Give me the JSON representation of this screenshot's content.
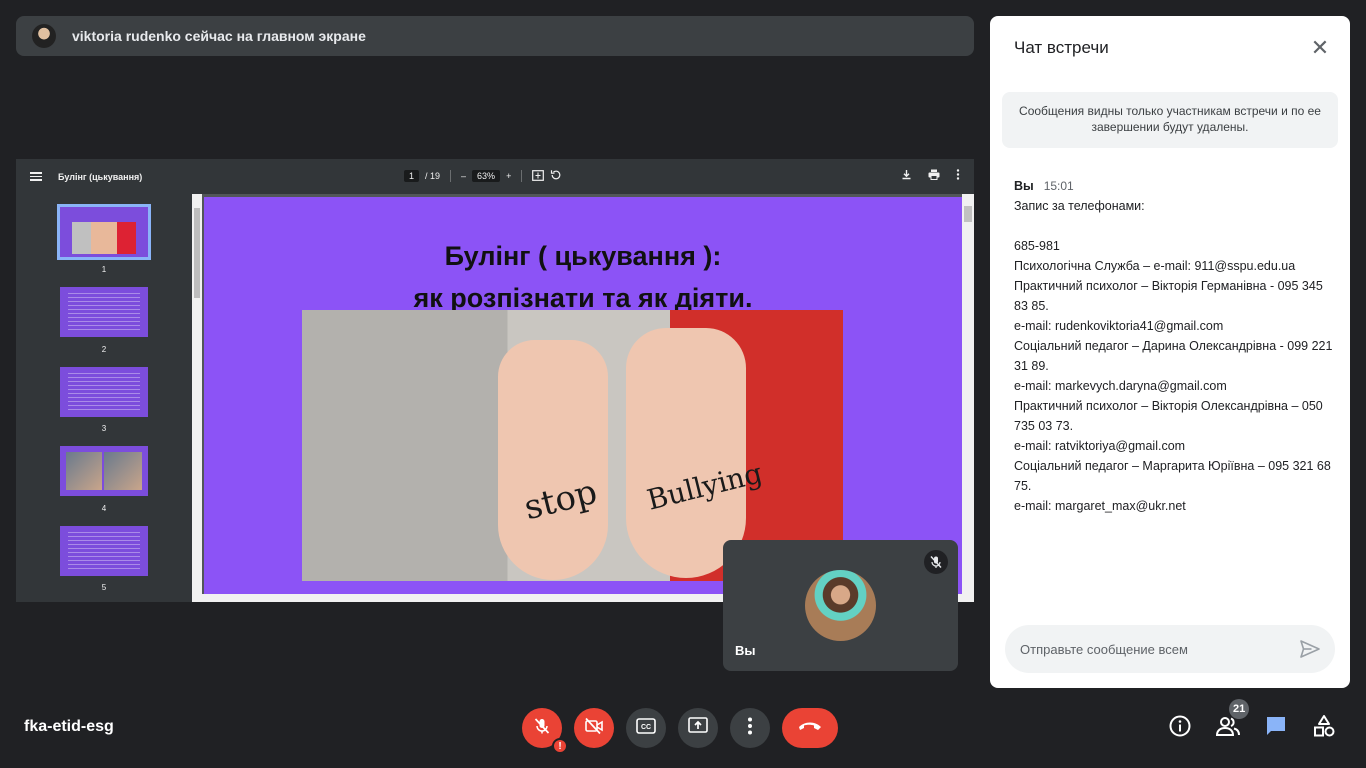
{
  "banner": {
    "presenter_text": "viktoria rudenko сейчас на главном экране"
  },
  "pdf": {
    "title": "Булінг (цькування)",
    "page_current": "1",
    "page_total": "/ 19",
    "zoom": "63%",
    "zoom_out": "–",
    "zoom_in": "+",
    "thumbnails": [
      {
        "number": "1",
        "selected": true
      },
      {
        "number": "2",
        "selected": false
      },
      {
        "number": "3",
        "selected": false
      },
      {
        "number": "4",
        "selected": false
      },
      {
        "number": "5",
        "selected": false
      }
    ],
    "slide": {
      "title_line1": "Булінг ( цькування ):",
      "title_line2": "як розпізнати та як діяти.",
      "hand_left": "stop",
      "hand_right": "Bullying"
    }
  },
  "self_tile": {
    "name": "Вы"
  },
  "chat": {
    "title": "Чат встречи",
    "notice": "Сообщения видны только участникам встречи и по ее завершении будут удалены.",
    "message": {
      "sender": "Вы",
      "time": "15:01",
      "lines": [
        "Запис за телефонами:",
        "",
        "685-981",
        "Психологічна Служба – e-mail: 911@sspu.edu.ua",
        "Практичний психолог – Вікторія Германівна - 095 345 83 85.",
        "e-mail: rudenkoviktoria41@gmail.com",
        "Соціальний педагог – Дарина Олександрівна - 099 221 31 89.",
        "e-mail: markevych.daryna@gmail.com",
        "Практичний психолог – Вікторія Олександрівна – 050 735 03 73.",
        "e-mail: ratviktoriya@gmail.com",
        "Соціальний педагог – Маргарита Юріївна – 095 321 68 75.",
        "e-mail: margaret_max@ukr.net"
      ]
    },
    "input_placeholder": "Отправьте сообщение всем",
    "input_value": ""
  },
  "bottom_bar": {
    "meeting_code": "fka-etid-esg",
    "participants_count": "21",
    "mic_warning": "!"
  },
  "colors": {
    "background": "#202124",
    "danger": "#ea4335",
    "chat_icon": "#8ab4f8",
    "slide_bg": "#8c53f6"
  },
  "icons": {
    "mic": "mic-off-icon",
    "camera": "camera-off-icon",
    "captions": "captions-icon",
    "present": "present-screen-icon",
    "more": "more-vertical-icon",
    "end": "end-call-icon",
    "info": "info-icon",
    "people": "people-icon",
    "chat": "chat-icon",
    "activities": "activities-icon"
  }
}
